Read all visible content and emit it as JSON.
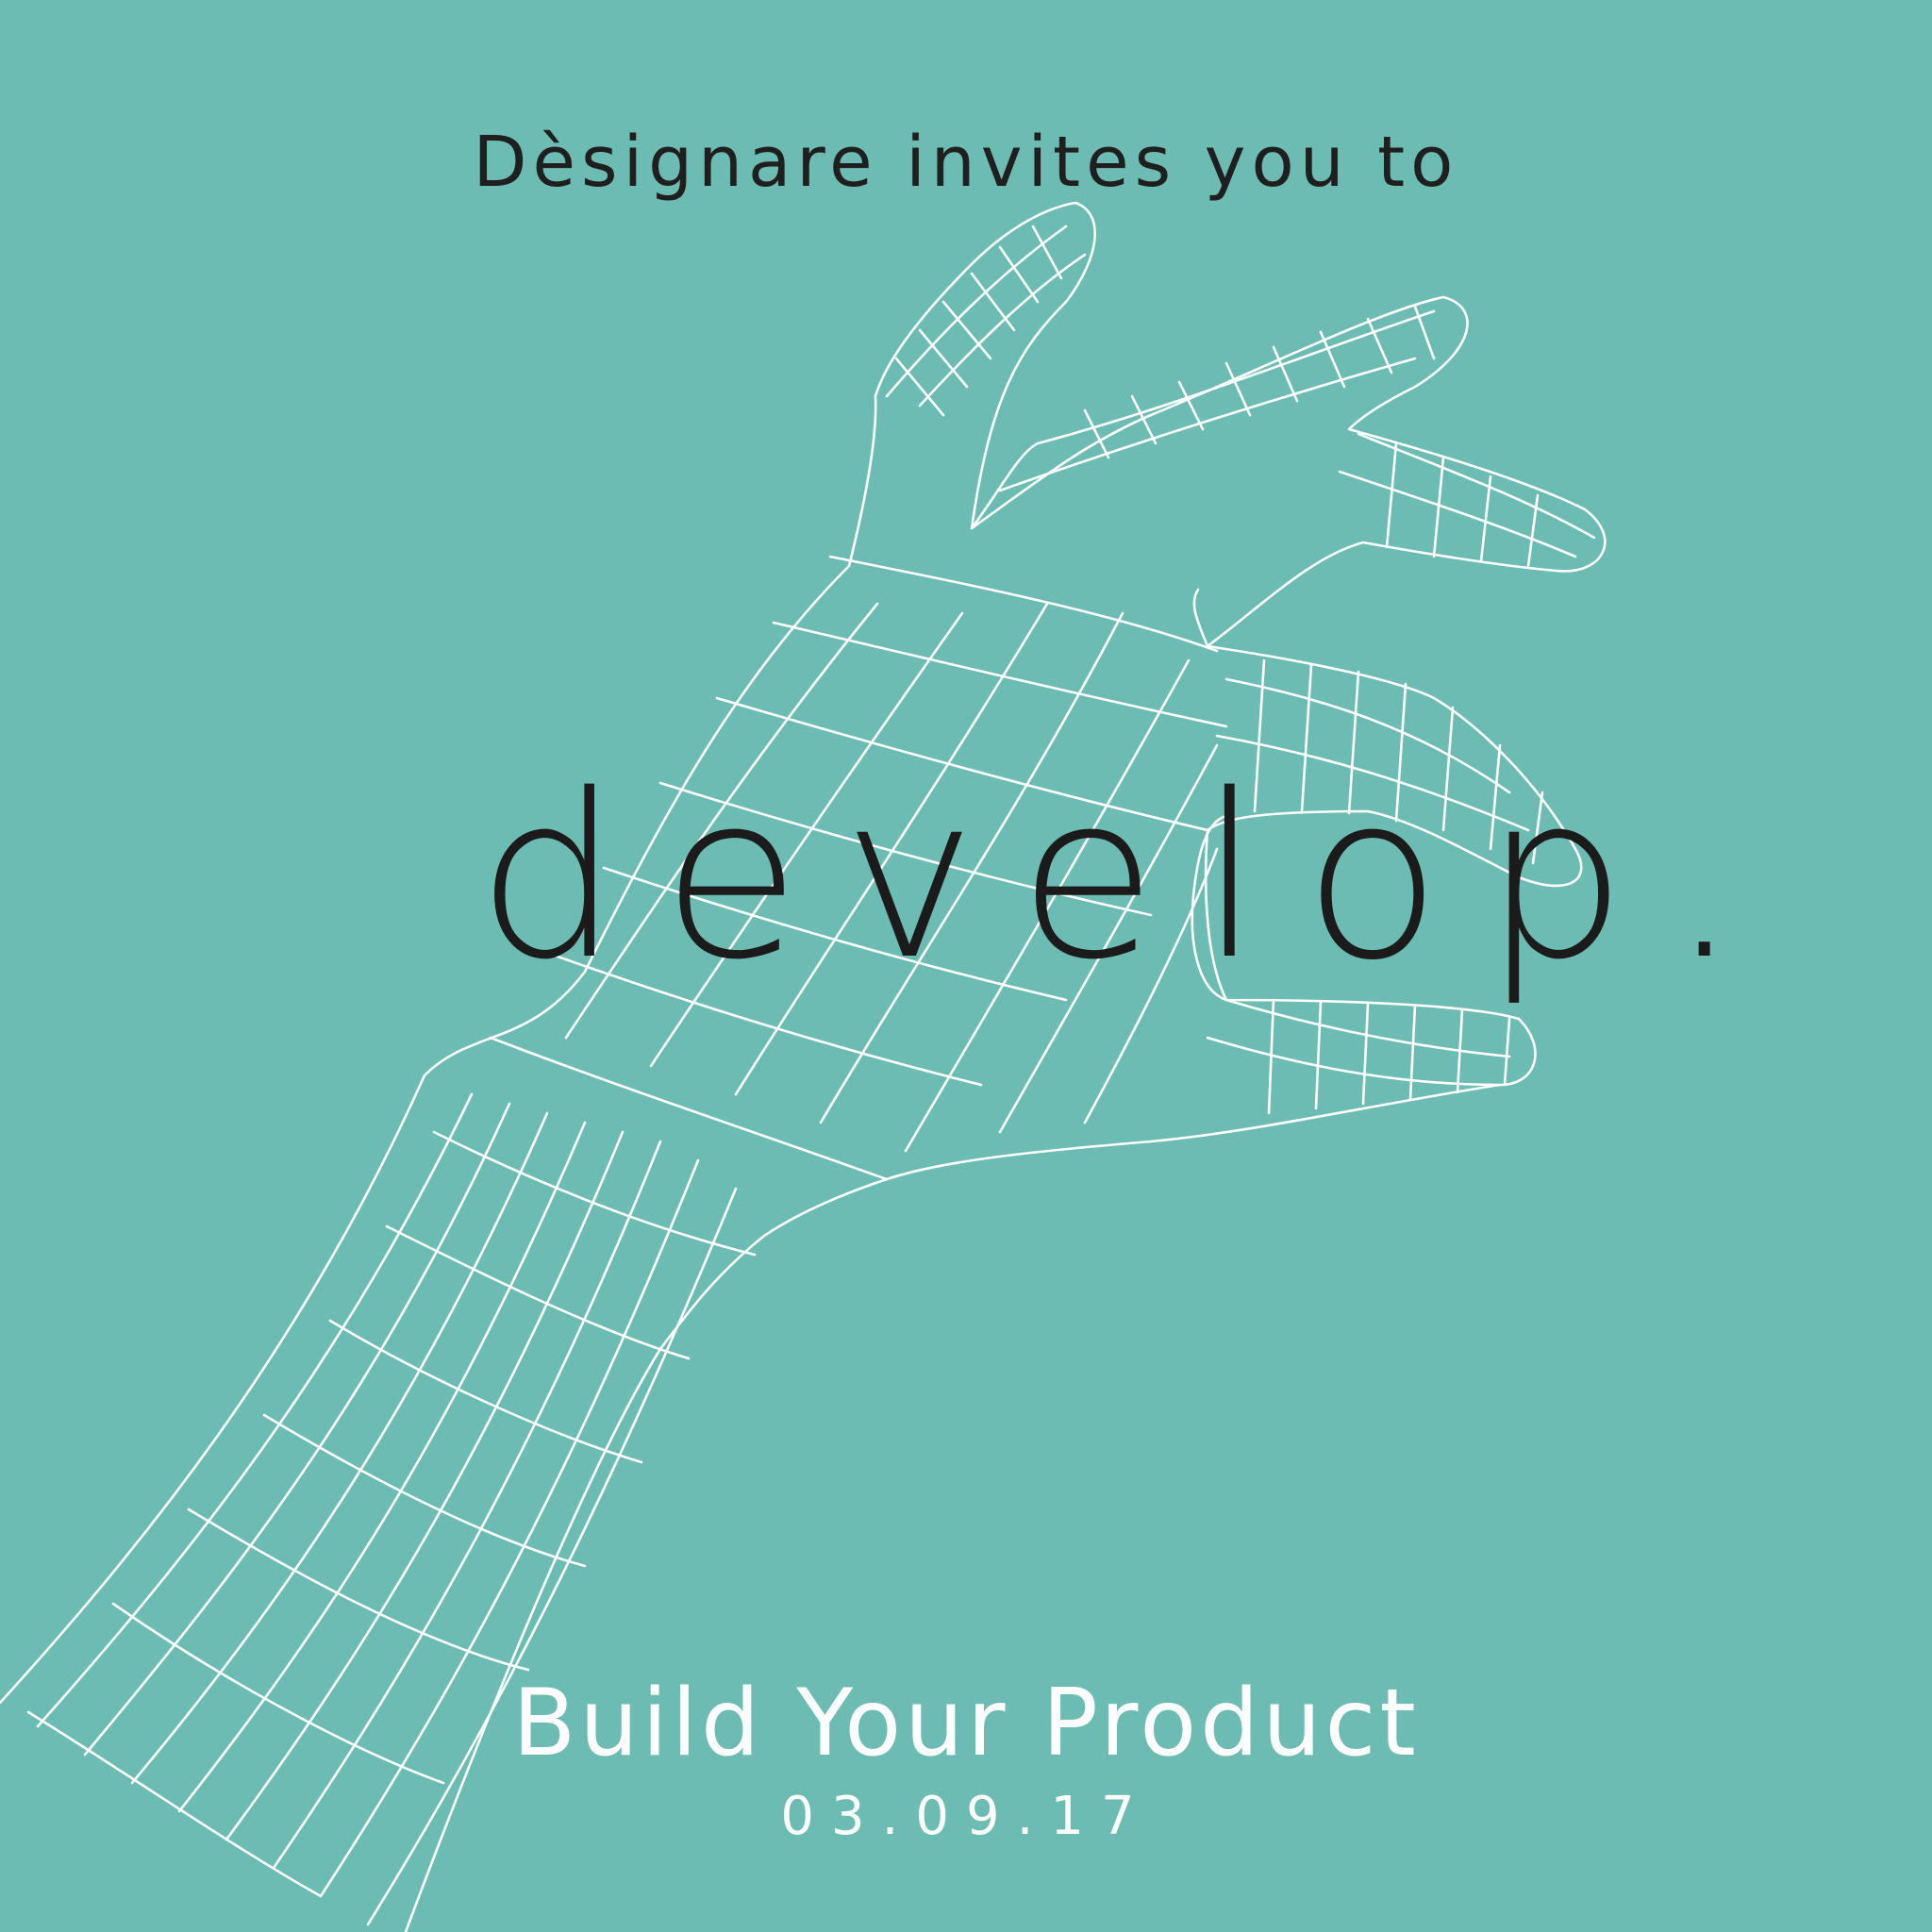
{
  "poster": {
    "invite_line": "Dèsignare invites you to",
    "headline": "develop.",
    "event_title": "Build Your Product",
    "event_date": "03.09.17"
  },
  "colors": {
    "background": "#6cbcb3",
    "dark_text": "#1f1f1f",
    "light_text": "#ffffff",
    "wireframe": "#ffffff"
  },
  "illustration": {
    "icon": "wireframe-hand-icon"
  }
}
